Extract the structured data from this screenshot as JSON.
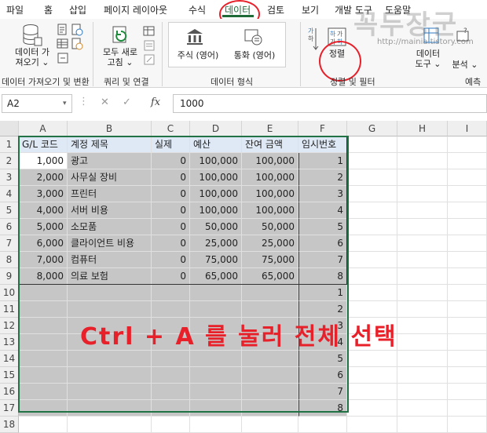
{
  "menu": {
    "tabs": [
      "파일",
      "홈",
      "삽입",
      "페이지 레이아웃",
      "수식",
      "데이터",
      "검토",
      "보기",
      "개발 도구",
      "도움말"
    ],
    "active": "데이터"
  },
  "watermark": {
    "text": "꼭두장군",
    "url": "http://mainia.tistory.com"
  },
  "ribbon": {
    "get_data": "데이터 가\n져오기 ⌄",
    "refresh_all": "모두 새로\n고침 ⌄",
    "stocks": "주식 (영어)",
    "currency": "통화 (영어)",
    "sort": "정렬",
    "data_tools": "데이터\n도구 ⌄",
    "analysis": "분석 ⌄",
    "groups": {
      "get_transform": "데이터 가져오기 및 변환",
      "queries": "쿼리 및 연결",
      "data_types": "데이터 형식",
      "sort_filter": "정렬 및 필터",
      "forecast": "예측"
    }
  },
  "formula_bar": {
    "name_box": "A2",
    "fx": "fx",
    "value": "1000"
  },
  "columns": [
    "A",
    "B",
    "C",
    "D",
    "E",
    "F",
    "G",
    "H",
    "I"
  ],
  "rows": [
    "1",
    "2",
    "3",
    "4",
    "5",
    "6",
    "7",
    "8",
    "9",
    "10",
    "11",
    "12",
    "13",
    "14",
    "15",
    "16",
    "17",
    "18"
  ],
  "table": {
    "headers": [
      "G/L 코드",
      "계정 제목",
      "실제",
      "예산",
      "잔여 금액",
      "임시번호"
    ],
    "data": [
      [
        "1,000",
        "광고",
        "0",
        "100,000",
        "100,000",
        "1"
      ],
      [
        "2,000",
        "사무실 장비",
        "0",
        "100,000",
        "100,000",
        "2"
      ],
      [
        "3,000",
        "프린터",
        "0",
        "100,000",
        "100,000",
        "3"
      ],
      [
        "4,000",
        "서버 비용",
        "0",
        "100,000",
        "100,000",
        "4"
      ],
      [
        "5,000",
        "소모품",
        "0",
        "50,000",
        "50,000",
        "5"
      ],
      [
        "6,000",
        "클라이언트 비용",
        "0",
        "25,000",
        "25,000",
        "6"
      ],
      [
        "7,000",
        "컴퓨터",
        "0",
        "75,000",
        "75,000",
        "7"
      ],
      [
        "8,000",
        "의료 보험",
        "0",
        "65,000",
        "65,000",
        "8"
      ]
    ],
    "extra_f": [
      "1",
      "2",
      "3",
      "4",
      "5",
      "6",
      "7",
      "8"
    ]
  },
  "annotation": "Ctrl + A 를 눌러 전체 선택",
  "colors": {
    "accent": "#1e6b37",
    "selection": "#c6c6c6",
    "annotation": "#e8202a",
    "header_fill": "#dfe9f5"
  }
}
